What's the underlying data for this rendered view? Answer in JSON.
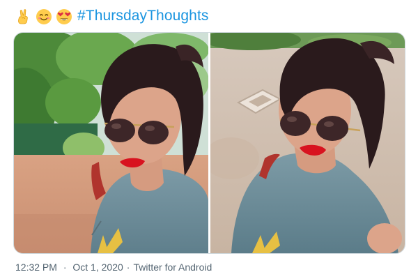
{
  "tweet": {
    "emojis": [
      "victory-hand-emoji",
      "smiling-face-emoji",
      "heart-eyes-emoji"
    ],
    "hashtag": "#ThursdayThoughts"
  },
  "media": {
    "photos": [
      {
        "name": "photo-1"
      },
      {
        "name": "photo-2"
      }
    ]
  },
  "meta": {
    "time": "12:32 PM",
    "date": "Oct 1, 2020",
    "separator": "·",
    "source": "Twitter for Android"
  },
  "colors": {
    "link": "#1b95e0",
    "meta_text": "#536471",
    "border": "#cfd9de"
  }
}
